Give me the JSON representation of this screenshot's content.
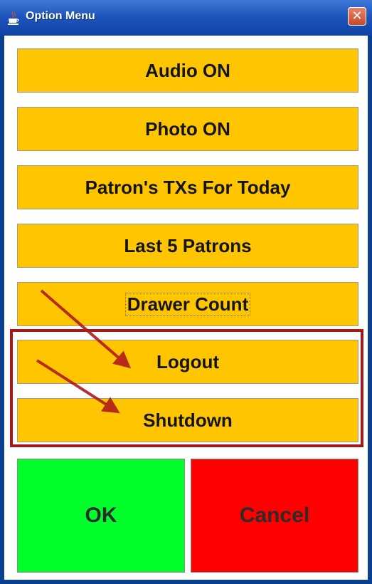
{
  "window": {
    "title": "Option Menu",
    "app_icon": "java-cup-icon",
    "close_icon": "close-icon",
    "close_glyph": "✕"
  },
  "menu": {
    "items": [
      {
        "label": "Audio ON"
      },
      {
        "label": "Photo ON"
      },
      {
        "label": "Patron's TXs For Today"
      },
      {
        "label": "Last 5 Patrons"
      },
      {
        "label": "Drawer Count"
      },
      {
        "label": "Logout"
      },
      {
        "label": "Shutdown"
      }
    ]
  },
  "actions": {
    "ok_label": "OK",
    "cancel_label": "Cancel"
  },
  "colors": {
    "option_button": "#ffc600",
    "ok_button": "#00ff2a",
    "cancel_button": "#ff0000",
    "annotation": "#a21a1a"
  }
}
